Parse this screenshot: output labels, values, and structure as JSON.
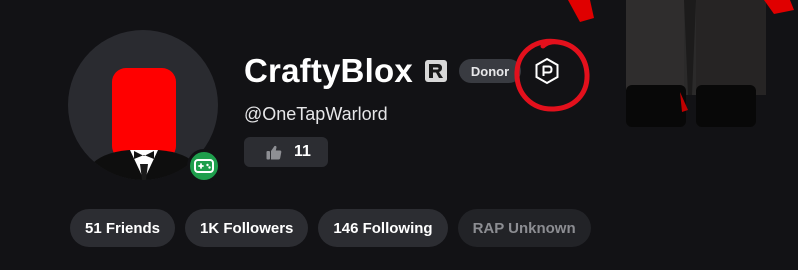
{
  "profile": {
    "display_name": "CraftyBlox",
    "username": "@OneTapWarlord",
    "badge": "Donor",
    "likes": "11"
  },
  "stats": [
    {
      "label": "51 Friends"
    },
    {
      "label": "1K Followers"
    },
    {
      "label": "146 Following"
    },
    {
      "label": "RAP Unknown"
    }
  ],
  "icons": {
    "verified": "verified-r-icon",
    "premium": "premium-hexagon-icon",
    "presence": "gamepad-icon",
    "like": "thumbs-up-icon"
  },
  "colors": {
    "background": "#121215",
    "presence_green": "#1e9e4c",
    "annotation_red": "#e3101c",
    "avatar_head_red": "#ff0000"
  }
}
